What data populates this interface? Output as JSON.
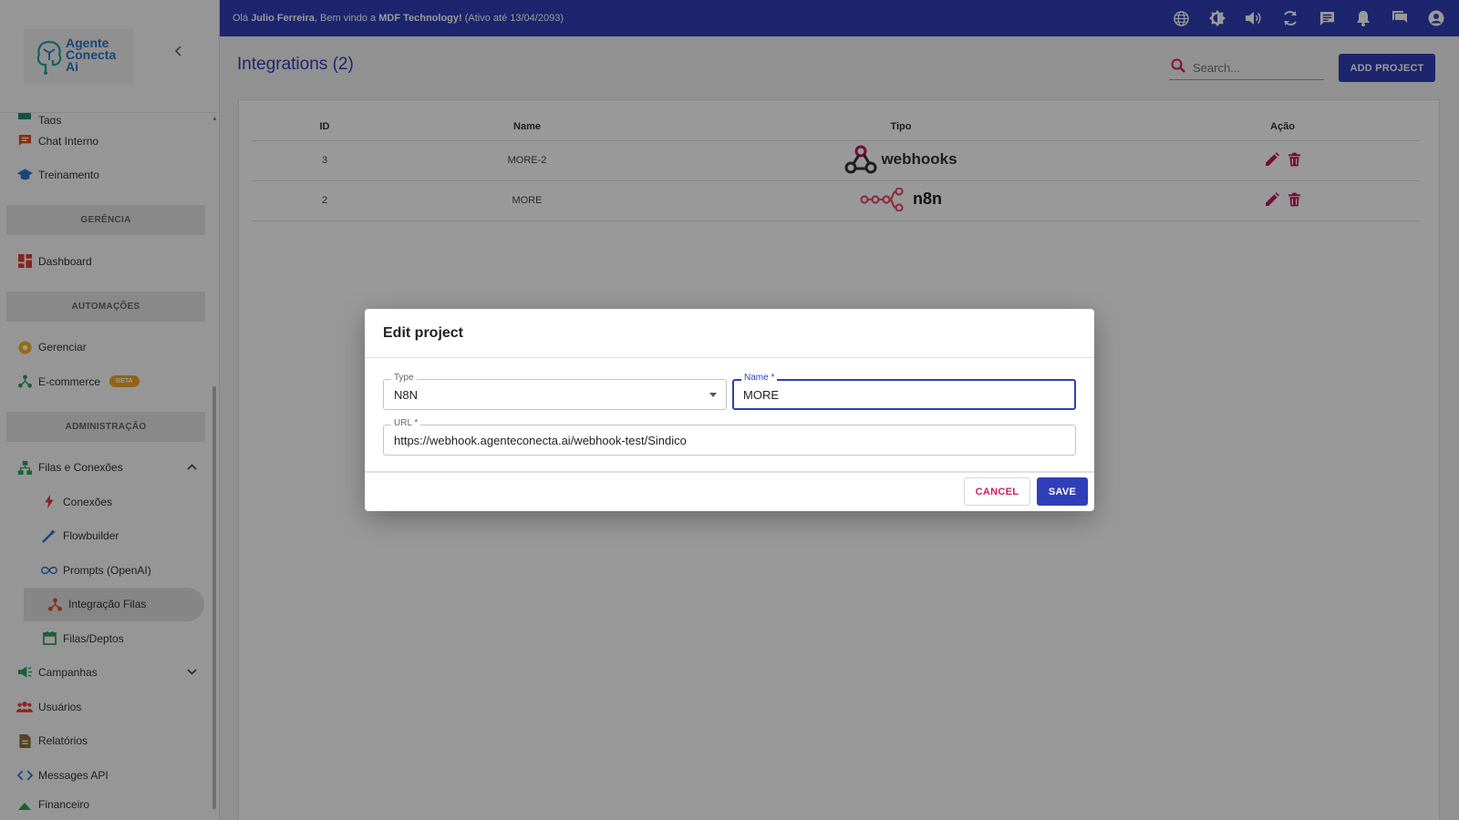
{
  "topbar": {
    "greeting": "Olá ",
    "user": "Julio Ferreira",
    "welcome": ", Bem vindo a ",
    "company": "MDF Technology!",
    "active_until": " (Ativo até 13/04/2093)",
    "icons": [
      "globe-icon",
      "theme-icon",
      "volume-icon",
      "refresh-icon",
      "chat-icon",
      "bell-icon",
      "messages-icon",
      "account-icon"
    ]
  },
  "logo": {
    "line1": "Agente",
    "line2": "Conecta",
    "line3": "Ai"
  },
  "sidebar": {
    "tags": "Tags",
    "chat_interno": "Chat Interno",
    "treinamento": "Treinamento",
    "section_gerencia": "GERÊNCIA",
    "dashboard": "Dashboard",
    "section_automacoes": "AUTOMAÇÕES",
    "gerenciar": "Gerenciar",
    "ecommerce": "E-commerce",
    "beta": "BETA",
    "section_admin": "ADMINISTRAÇÃO",
    "filas_conexoes": "Filas e Conexões",
    "conexoes": "Conexões",
    "flowbuilder": "Flowbuilder",
    "prompts": "Prompts (OpenAI)",
    "integracao_filas": "Integração Filas",
    "filas_deptos": "Filas/Deptos",
    "campanhas": "Campanhas",
    "usuarios": "Usuários",
    "relatorios": "Relatórios",
    "messages_api": "Messages API",
    "financeiro": "Financeiro"
  },
  "main": {
    "title": "Integrations (2)",
    "search_placeholder": "Search...",
    "add_button": "ADD PROJECT",
    "columns": {
      "id": "ID",
      "name": "Name",
      "tipo": "Tipo",
      "acao": "Ação"
    },
    "rows": [
      {
        "id": "3",
        "name": "MORE-2",
        "tipo": "webhooks"
      },
      {
        "id": "2",
        "name": "MORE",
        "tipo": "n8n"
      }
    ]
  },
  "dialog": {
    "title": "Edit project",
    "type_label": "Type",
    "type_value": "N8N",
    "name_label": "Name *",
    "name_value": "MORE",
    "url_label": "URL *",
    "url_value": "https://webhook.agenteconecta.ai/webhook-test/Sindico",
    "cancel": "CANCEL",
    "save": "SAVE"
  },
  "colors": {
    "primary": "#2f3fb8",
    "danger": "#d81b60",
    "accent": "#f5a623"
  }
}
